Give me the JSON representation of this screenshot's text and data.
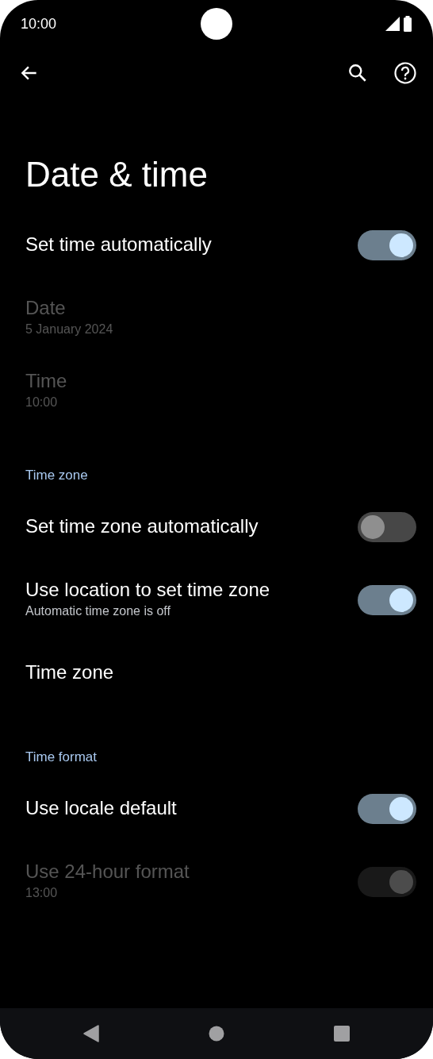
{
  "status_bar": {
    "time": "10:00"
  },
  "title": "Date & time",
  "items": [
    {
      "kind": "toggle",
      "title": "Set time automatically",
      "disabled": false,
      "checked": true
    },
    {
      "kind": "link",
      "title": "Date",
      "subtitle": "5 January 2024",
      "disabled": true
    },
    {
      "kind": "link",
      "title": "Time",
      "subtitle": "10:00",
      "disabled": true
    },
    {
      "kind": "header",
      "title": "Time zone"
    },
    {
      "kind": "toggle",
      "title": "Set time zone automatically",
      "disabled": false,
      "checked": false
    },
    {
      "kind": "toggle",
      "title": "Use location to set time zone",
      "subtitle": "Automatic time zone is off",
      "disabled": false,
      "checked": true
    },
    {
      "kind": "link",
      "title": "Time zone",
      "disabled": false
    },
    {
      "kind": "header",
      "title": "Time format"
    },
    {
      "kind": "toggle",
      "title": "Use locale default",
      "disabled": false,
      "checked": true
    },
    {
      "kind": "toggle",
      "title": "Use 24-hour format",
      "subtitle": "13:00",
      "disabled": true,
      "checked": true
    }
  ]
}
